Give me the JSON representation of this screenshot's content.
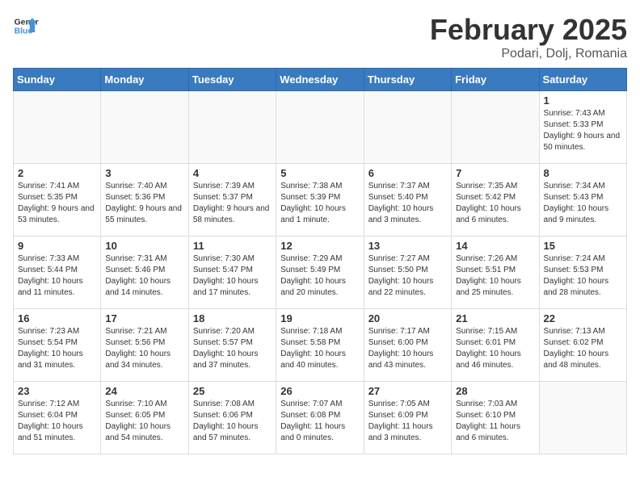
{
  "header": {
    "logo_general": "General",
    "logo_blue": "Blue",
    "title": "February 2025",
    "subtitle": "Podari, Dolj, Romania"
  },
  "days_of_week": [
    "Sunday",
    "Monday",
    "Tuesday",
    "Wednesday",
    "Thursday",
    "Friday",
    "Saturday"
  ],
  "weeks": [
    [
      {
        "day": "",
        "info": ""
      },
      {
        "day": "",
        "info": ""
      },
      {
        "day": "",
        "info": ""
      },
      {
        "day": "",
        "info": ""
      },
      {
        "day": "",
        "info": ""
      },
      {
        "day": "",
        "info": ""
      },
      {
        "day": "1",
        "info": "Sunrise: 7:43 AM\nSunset: 5:33 PM\nDaylight: 9 hours and 50 minutes."
      }
    ],
    [
      {
        "day": "2",
        "info": "Sunrise: 7:41 AM\nSunset: 5:35 PM\nDaylight: 9 hours and 53 minutes."
      },
      {
        "day": "3",
        "info": "Sunrise: 7:40 AM\nSunset: 5:36 PM\nDaylight: 9 hours and 55 minutes."
      },
      {
        "day": "4",
        "info": "Sunrise: 7:39 AM\nSunset: 5:37 PM\nDaylight: 9 hours and 58 minutes."
      },
      {
        "day": "5",
        "info": "Sunrise: 7:38 AM\nSunset: 5:39 PM\nDaylight: 10 hours and 1 minute."
      },
      {
        "day": "6",
        "info": "Sunrise: 7:37 AM\nSunset: 5:40 PM\nDaylight: 10 hours and 3 minutes."
      },
      {
        "day": "7",
        "info": "Sunrise: 7:35 AM\nSunset: 5:42 PM\nDaylight: 10 hours and 6 minutes."
      },
      {
        "day": "8",
        "info": "Sunrise: 7:34 AM\nSunset: 5:43 PM\nDaylight: 10 hours and 9 minutes."
      }
    ],
    [
      {
        "day": "9",
        "info": "Sunrise: 7:33 AM\nSunset: 5:44 PM\nDaylight: 10 hours and 11 minutes."
      },
      {
        "day": "10",
        "info": "Sunrise: 7:31 AM\nSunset: 5:46 PM\nDaylight: 10 hours and 14 minutes."
      },
      {
        "day": "11",
        "info": "Sunrise: 7:30 AM\nSunset: 5:47 PM\nDaylight: 10 hours and 17 minutes."
      },
      {
        "day": "12",
        "info": "Sunrise: 7:29 AM\nSunset: 5:49 PM\nDaylight: 10 hours and 20 minutes."
      },
      {
        "day": "13",
        "info": "Sunrise: 7:27 AM\nSunset: 5:50 PM\nDaylight: 10 hours and 22 minutes."
      },
      {
        "day": "14",
        "info": "Sunrise: 7:26 AM\nSunset: 5:51 PM\nDaylight: 10 hours and 25 minutes."
      },
      {
        "day": "15",
        "info": "Sunrise: 7:24 AM\nSunset: 5:53 PM\nDaylight: 10 hours and 28 minutes."
      }
    ],
    [
      {
        "day": "16",
        "info": "Sunrise: 7:23 AM\nSunset: 5:54 PM\nDaylight: 10 hours and 31 minutes."
      },
      {
        "day": "17",
        "info": "Sunrise: 7:21 AM\nSunset: 5:56 PM\nDaylight: 10 hours and 34 minutes."
      },
      {
        "day": "18",
        "info": "Sunrise: 7:20 AM\nSunset: 5:57 PM\nDaylight: 10 hours and 37 minutes."
      },
      {
        "day": "19",
        "info": "Sunrise: 7:18 AM\nSunset: 5:58 PM\nDaylight: 10 hours and 40 minutes."
      },
      {
        "day": "20",
        "info": "Sunrise: 7:17 AM\nSunset: 6:00 PM\nDaylight: 10 hours and 43 minutes."
      },
      {
        "day": "21",
        "info": "Sunrise: 7:15 AM\nSunset: 6:01 PM\nDaylight: 10 hours and 46 minutes."
      },
      {
        "day": "22",
        "info": "Sunrise: 7:13 AM\nSunset: 6:02 PM\nDaylight: 10 hours and 48 minutes."
      }
    ],
    [
      {
        "day": "23",
        "info": "Sunrise: 7:12 AM\nSunset: 6:04 PM\nDaylight: 10 hours and 51 minutes."
      },
      {
        "day": "24",
        "info": "Sunrise: 7:10 AM\nSunset: 6:05 PM\nDaylight: 10 hours and 54 minutes."
      },
      {
        "day": "25",
        "info": "Sunrise: 7:08 AM\nSunset: 6:06 PM\nDaylight: 10 hours and 57 minutes."
      },
      {
        "day": "26",
        "info": "Sunrise: 7:07 AM\nSunset: 6:08 PM\nDaylight: 11 hours and 0 minutes."
      },
      {
        "day": "27",
        "info": "Sunrise: 7:05 AM\nSunset: 6:09 PM\nDaylight: 11 hours and 3 minutes."
      },
      {
        "day": "28",
        "info": "Sunrise: 7:03 AM\nSunset: 6:10 PM\nDaylight: 11 hours and 6 minutes."
      },
      {
        "day": "",
        "info": ""
      }
    ]
  ]
}
